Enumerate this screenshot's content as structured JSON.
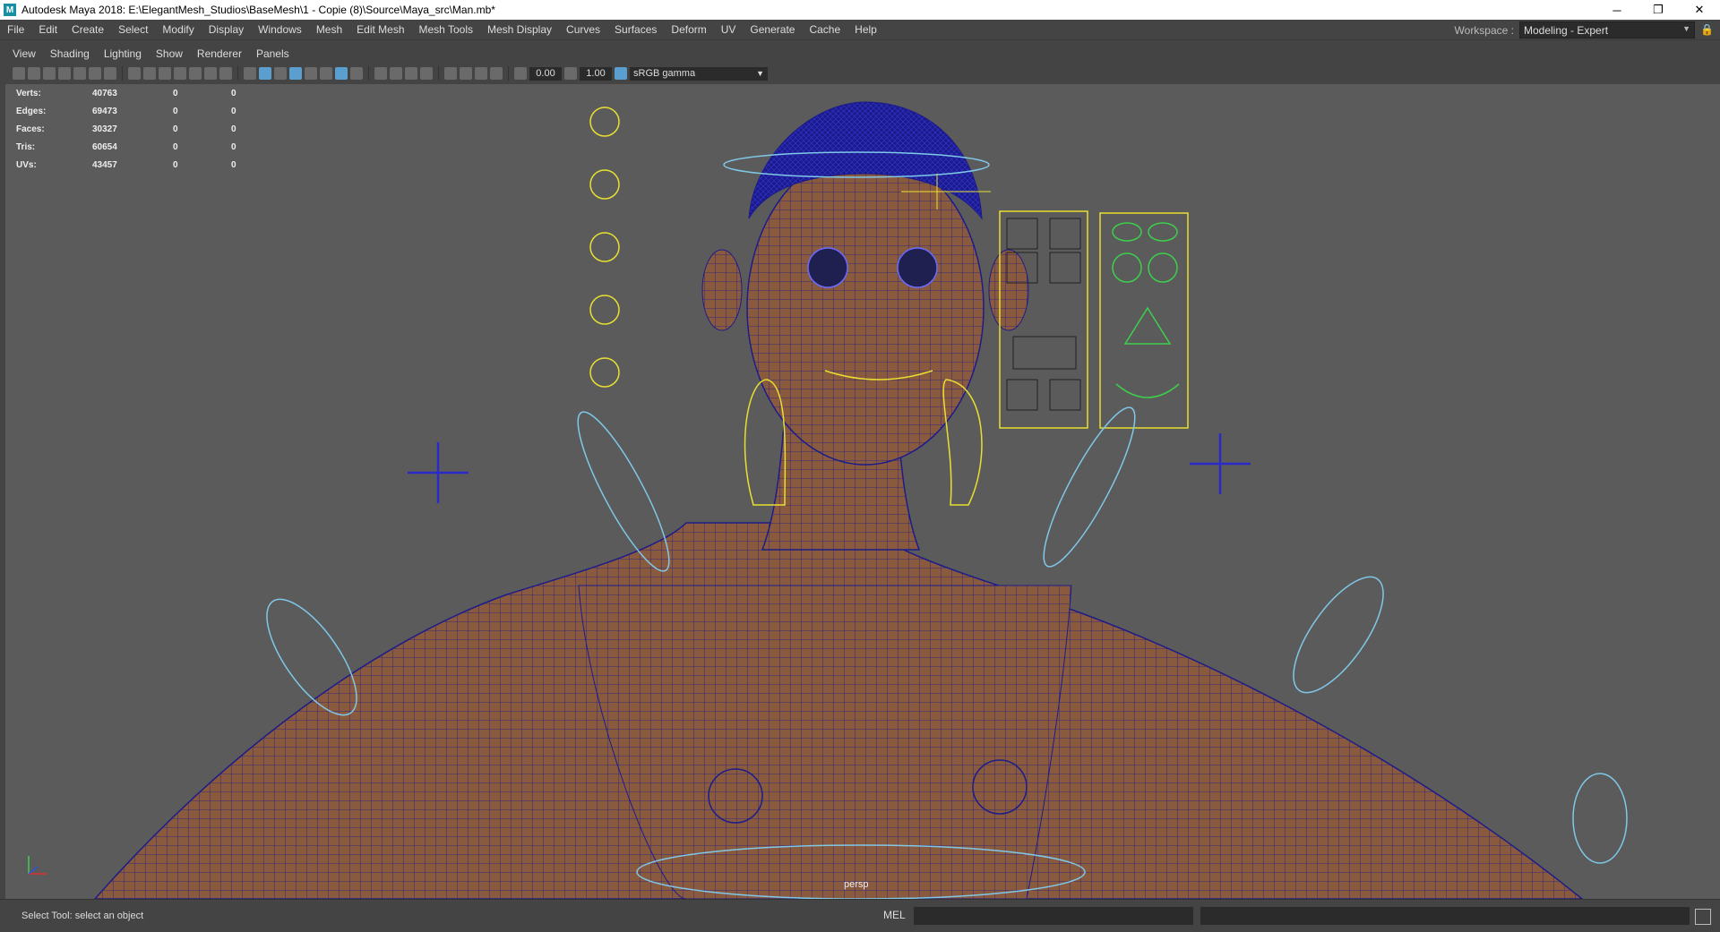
{
  "window": {
    "title": "Autodesk Maya 2018: E:\\ElegantMesh_Studios\\BaseMesh\\1 - Copie (8)\\Source\\Maya_src\\Man.mb*",
    "app_icon": "M",
    "controls": [
      "─",
      "❐",
      "✕"
    ]
  },
  "menubar": {
    "items": [
      "File",
      "Edit",
      "Create",
      "Select",
      "Modify",
      "Display",
      "Windows",
      "Mesh",
      "Edit Mesh",
      "Mesh Tools",
      "Mesh Display",
      "Curves",
      "Surfaces",
      "Deform",
      "UV",
      "Generate",
      "Cache",
      "Help"
    ]
  },
  "workspace": {
    "label": "Workspace :",
    "value": "Modeling - Expert"
  },
  "panel_menu": {
    "items": [
      "View",
      "Shading",
      "Lighting",
      "Show",
      "Renderer",
      "Panels"
    ]
  },
  "toolbar": {
    "exposure": "0.00",
    "gamma": "1.00",
    "color_space": "sRGB gamma"
  },
  "hud": {
    "rows": [
      {
        "label": "Verts:",
        "v1": "40763",
        "v2": "0",
        "v3": "0"
      },
      {
        "label": "Edges:",
        "v1": "69473",
        "v2": "0",
        "v3": "0"
      },
      {
        "label": "Faces:",
        "v1": "30327",
        "v2": "0",
        "v3": "0"
      },
      {
        "label": "Tris:",
        "v1": "60654",
        "v2": "0",
        "v3": "0"
      },
      {
        "label": "UVs:",
        "v1": "43457",
        "v2": "0",
        "v3": "0"
      }
    ]
  },
  "viewport": {
    "camera": "persp",
    "mesh_color": "#8a5a3e",
    "wire_color": "#1c1c8a",
    "ctrl_yellow": "#e8e030",
    "ctrl_cyan": "#7fc8e8",
    "ctrl_green": "#3cd04c"
  },
  "statusbar": {
    "help_line": "Select Tool: select an object",
    "mel_label": "MEL"
  }
}
